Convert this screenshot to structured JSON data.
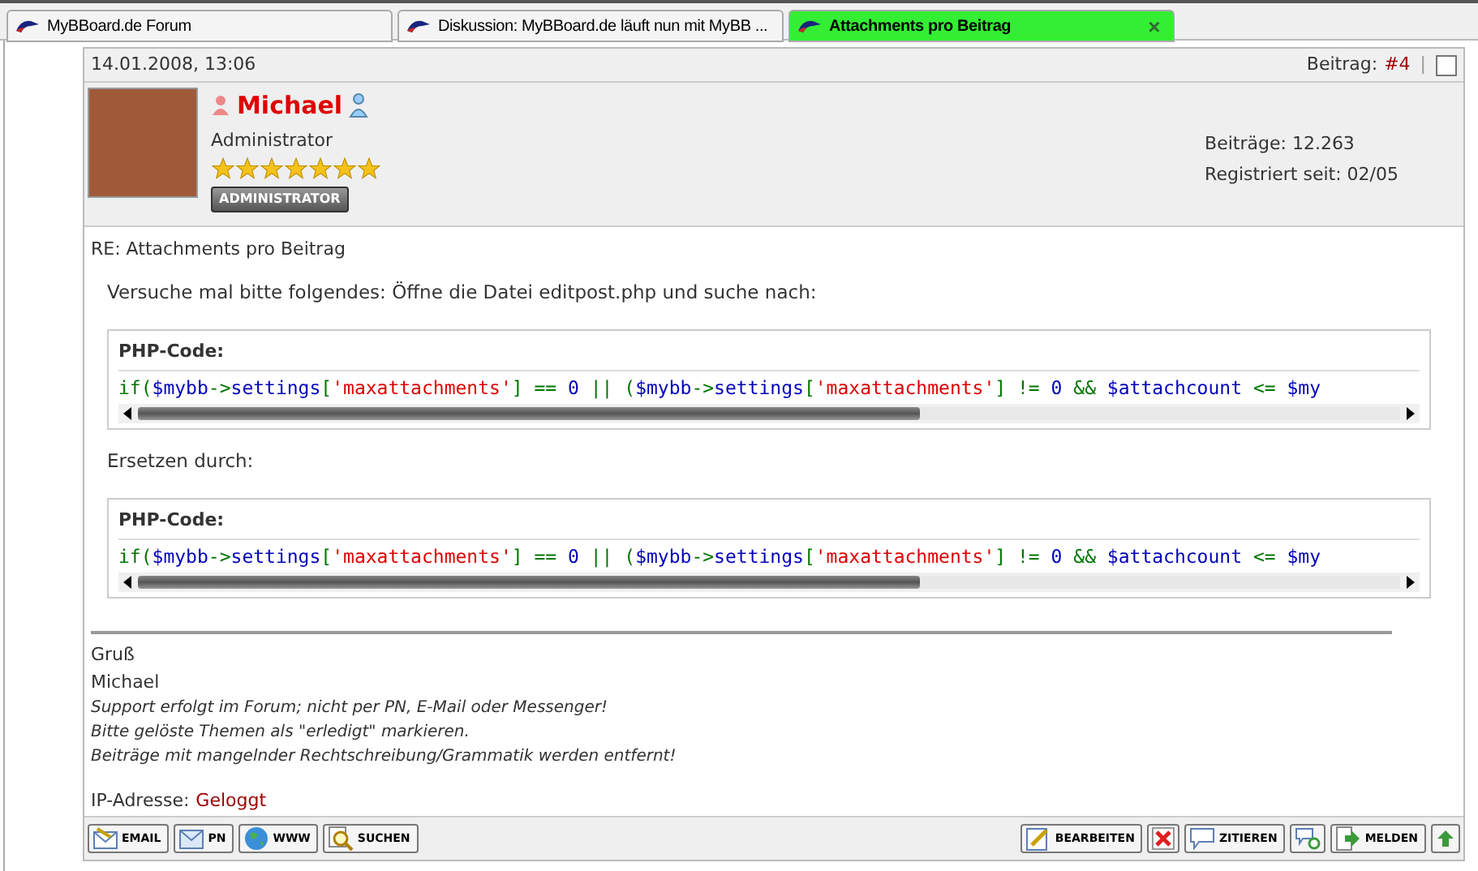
{
  "tabs": [
    {
      "label": "MyBBoard.de Forum",
      "selected": false
    },
    {
      "label": "Diskussion: MyBBoard.de läuft nun mit MyBB ...",
      "selected": false
    },
    {
      "label": "Attachments pro Beitrag",
      "selected": true,
      "close": "×"
    }
  ],
  "post": {
    "date": "14.01.2008, 13:06",
    "number_label": "Beitrag:",
    "number": "#4",
    "separator": "|",
    "select_checked": false,
    "author": {
      "name": "Michael",
      "title": "Administrator",
      "stars": 7,
      "group_badge": "ADMINISTRATOR",
      "stats": [
        "Beiträge: 12.263",
        "Registriert seit: 02/05"
      ]
    },
    "subject": "RE: Attachments pro Beitrag",
    "body": [
      {
        "kind": "text",
        "text": "Versuche mal bitte folgendes: Öffne die Datei editpost.php und suche nach:"
      },
      {
        "kind": "code",
        "title": "PHP-Code:",
        "segments": [
          {
            "kind": "keyword",
            "text": "if("
          },
          {
            "kind": "default",
            "text": "$mybb"
          },
          {
            "kind": "keyword",
            "text": "->"
          },
          {
            "kind": "default",
            "text": "settings"
          },
          {
            "kind": "keyword",
            "text": "["
          },
          {
            "kind": "string",
            "text": "'maxattachments'"
          },
          {
            "kind": "keyword",
            "text": "] == "
          },
          {
            "kind": "default",
            "text": "0 "
          },
          {
            "kind": "keyword",
            "text": "|| ("
          },
          {
            "kind": "default",
            "text": "$mybb"
          },
          {
            "kind": "keyword",
            "text": "->"
          },
          {
            "kind": "default",
            "text": "settings"
          },
          {
            "kind": "keyword",
            "text": "["
          },
          {
            "kind": "string",
            "text": "'maxattachments'"
          },
          {
            "kind": "keyword",
            "text": "] != "
          },
          {
            "kind": "default",
            "text": "0 "
          },
          {
            "kind": "keyword",
            "text": "&& "
          },
          {
            "kind": "default",
            "text": "$attachcount "
          },
          {
            "kind": "keyword",
            "text": "<= "
          },
          {
            "kind": "default",
            "text": "$my"
          }
        ]
      },
      {
        "kind": "text",
        "text": "Ersetzen durch:"
      },
      {
        "kind": "code",
        "title": "PHP-Code:",
        "segments": [
          {
            "kind": "keyword",
            "text": "if("
          },
          {
            "kind": "default",
            "text": "$mybb"
          },
          {
            "kind": "keyword",
            "text": "->"
          },
          {
            "kind": "default",
            "text": "settings"
          },
          {
            "kind": "keyword",
            "text": "["
          },
          {
            "kind": "string",
            "text": "'maxattachments'"
          },
          {
            "kind": "keyword",
            "text": "] == "
          },
          {
            "kind": "default",
            "text": "0 "
          },
          {
            "kind": "keyword",
            "text": "|| ("
          },
          {
            "kind": "default",
            "text": "$mybb"
          },
          {
            "kind": "keyword",
            "text": "->"
          },
          {
            "kind": "default",
            "text": "settings"
          },
          {
            "kind": "keyword",
            "text": "["
          },
          {
            "kind": "string",
            "text": "'maxattachments'"
          },
          {
            "kind": "keyword",
            "text": "] != "
          },
          {
            "kind": "default",
            "text": "0 "
          },
          {
            "kind": "keyword",
            "text": "&& "
          },
          {
            "kind": "default",
            "text": "$attachcount "
          },
          {
            "kind": "keyword",
            "text": "<= "
          },
          {
            "kind": "default",
            "text": "$my"
          }
        ]
      }
    ],
    "signature": {
      "lines": [
        "Gruß",
        "Michael"
      ],
      "italic_lines": [
        "Support erfolgt im Forum; nicht per PN, E-Mail oder Messenger!",
        "Bitte gelöste Themen als \"erledigt\" markieren.",
        "Beiträge mit mangelnder Rechtschreibung/Grammatik werden entfernt!"
      ]
    },
    "ip_label": "IP-Adresse:",
    "ip_value": "Geloggt",
    "left_buttons": [
      {
        "kind": "email",
        "label": "EMAIL"
      },
      {
        "kind": "pm",
        "label": "PN"
      },
      {
        "kind": "www",
        "label": "WWW"
      },
      {
        "kind": "search",
        "label": "SUCHEN"
      }
    ],
    "right_buttons": [
      {
        "kind": "edit",
        "label": "BEARBEITEN"
      },
      {
        "kind": "delete"
      },
      {
        "kind": "quote",
        "label": "ZITIEREN"
      },
      {
        "kind": "multiquote"
      },
      {
        "kind": "report",
        "label": "MELDEN"
      },
      {
        "kind": "top"
      }
    ]
  }
}
